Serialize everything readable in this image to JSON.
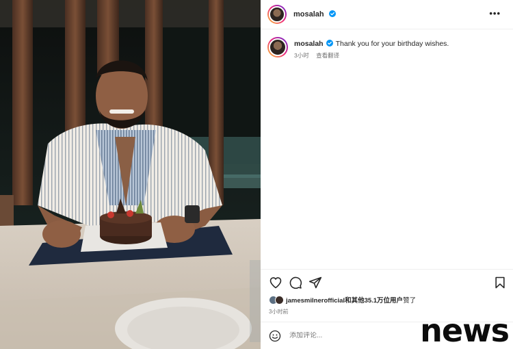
{
  "post": {
    "username": "mosalah",
    "more_icon": "more-horizontal-icon",
    "caption_text": "Thank you for your birthday wishes.",
    "caption_time": "3小时",
    "translate_label": "查看翻译",
    "likes_user": "jamesmilnerofficial",
    "likes_rest": "和其他35.1万位用户",
    "likes_suffix": "赞了",
    "timestamp": "3小时前",
    "comment_placeholder": "添加评论..."
  },
  "icons": [
    "verified-badge-icon",
    "heart-icon",
    "comment-icon",
    "share-icon",
    "bookmark-icon",
    "emoji-icon"
  ],
  "colors": {
    "verified": "#0095f6",
    "text": "#262626",
    "muted": "#737373",
    "divider": "#efefef"
  },
  "watermark": "news"
}
